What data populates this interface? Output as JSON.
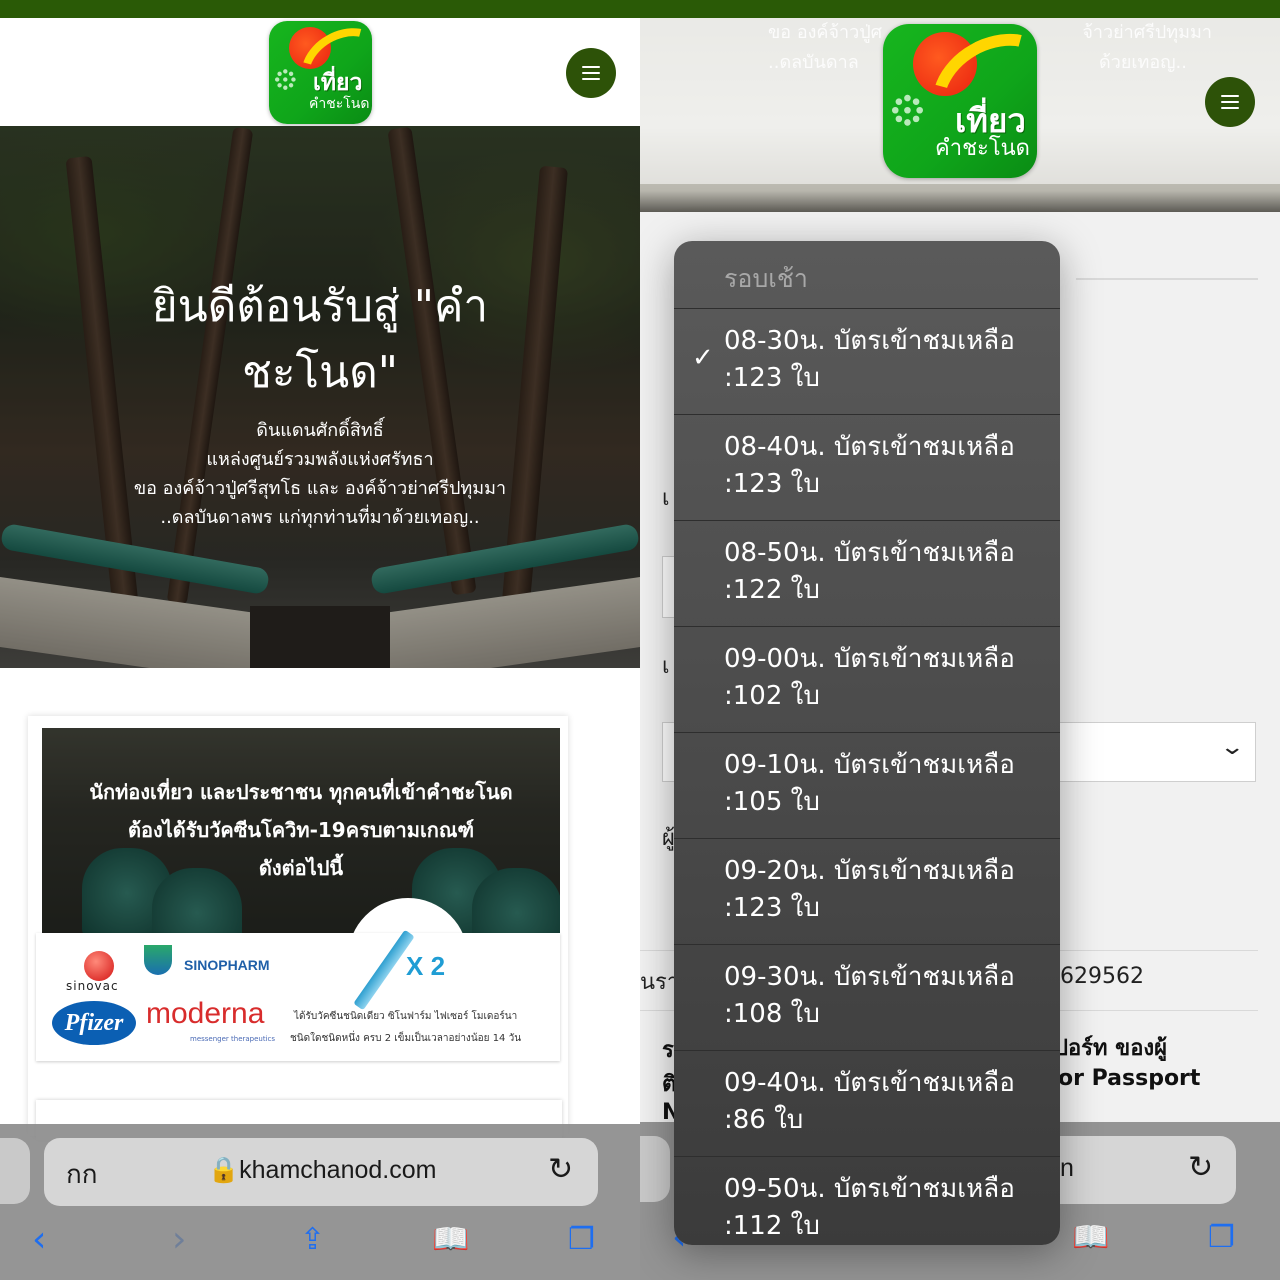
{
  "left": {
    "logo": {
      "line1": "เที่ยว",
      "line2": "คำชะโนด"
    },
    "hero": {
      "title_line1": "ยินดีต้อนรับสู่ \"คำ",
      "title_line2": "ชะโนด\"",
      "sub": [
        "ดินแดนศักดิ์สิทธิ์",
        "แหล่งศูนย์รวมพลังแห่งศรัทธา",
        "ขอ องค์จ้าวปู่ศรีสุทโธ และ องค์จ้าวย่าศรีปทุมมา",
        "..ดลบันดาลพร แก่ทุกท่านที่มาด้วยเทอญ.."
      ]
    },
    "vaccine": {
      "heading": [
        "นักท่องเที่ยว และประชาชน ทุกคนที่เข้าคำชะโนด",
        "ต้องได้รับวัคซีนโควิท-19ครบตามเกณฑ์",
        "ดังต่อไปนี้"
      ],
      "sinovac": "sinovac",
      "sinopharm": "SINOPHARM",
      "pfizer": "Pfizer",
      "moderna": "moderna",
      "moderna_sub": "messenger therapeutics",
      "dose": "X 2",
      "note1": "ได้รับวัคซีนชนิดเดียว ซิโนฟาร์ม ไฟเซอร์ โมเดอร์นา",
      "note2": "ชนิดใดชนิดหนึ่ง ครบ 2 เข็มเป็นเวลาอย่างน้อย 14 วัน"
    },
    "safari": {
      "aa": "กก",
      "url": "khamchanod.com"
    }
  },
  "right": {
    "faint_text": [
      "ขอ องค์จ้าวปู่ศ                                   จ้าวย่าศรีปทุมมา",
      "..ดลบันดาล                                          ด้วยเทอญ.."
    ],
    "bg_fragments": {
      "f1": "เ",
      "f2": "เ",
      "f3": "ผู้",
      "f4": "นรา",
      "f5": "629562",
      "f6": "ร",
      "f7": "ติ",
      "f8": "N",
      "f9": "ปอร์ท ของผู้",
      "f10": "or Passport",
      "f11": "n"
    },
    "dropdown": {
      "header": "รอบเช้า",
      "items": [
        {
          "line1": "08-30น. บัตรเข้าชมเหลือ",
          "line2": ":123 ใบ",
          "checked": true
        },
        {
          "line1": "08-40น. บัตรเข้าชมเหลือ",
          "line2": ":123 ใบ",
          "checked": false
        },
        {
          "line1": "08-50น. บัตรเข้าชมเหลือ",
          "line2": ":122 ใบ",
          "checked": false
        },
        {
          "line1": "09-00น. บัตรเข้าชมเหลือ",
          "line2": ":102 ใบ",
          "checked": false
        },
        {
          "line1": "09-10น. บัตรเข้าชมเหลือ",
          "line2": ":105 ใบ",
          "checked": false
        },
        {
          "line1": "09-20น. บัตรเข้าชมเหลือ",
          "line2": ":123 ใบ",
          "checked": false
        },
        {
          "line1": "09-30น. บัตรเข้าชมเหลือ",
          "line2": ":108 ใบ",
          "checked": false
        },
        {
          "line1": "09-40น. บัตรเข้าชมเหลือ",
          "line2": ":86 ใบ",
          "checked": false
        },
        {
          "line1": "09-50น. บัตรเข้าชมเหลือ",
          "line2": ":112 ใบ",
          "checked": false
        }
      ],
      "check_glyph": "✓"
    },
    "logo": {
      "line1": "เที่ยว",
      "line2": "คำชะโนด"
    }
  }
}
